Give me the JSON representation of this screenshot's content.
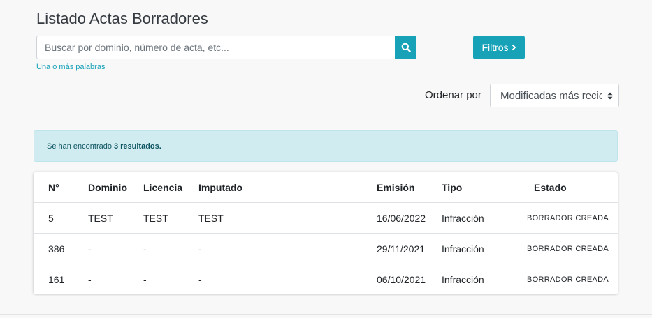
{
  "page": {
    "title": "Listado Actas Borradores"
  },
  "search": {
    "placeholder": "Buscar por dominio, número de acta, etc...",
    "value": "",
    "hint": "Una o más palabras",
    "button_icon": "search-icon"
  },
  "filters": {
    "label": "Filtros",
    "icon": "chevron-right-icon"
  },
  "order": {
    "label": "Ordenar por",
    "selected": "Modificadas más recientes"
  },
  "results": {
    "prefix": "Se han encontrado",
    "count_text": "3 resultados."
  },
  "table": {
    "headers": [
      "N°",
      "Dominio",
      "Licencia",
      "Imputado",
      "Emisión",
      "Tipo",
      "Estado"
    ],
    "rows": [
      {
        "num": "5",
        "dominio": "TEST",
        "licencia": "TEST",
        "imputado": "TEST",
        "emision": "16/06/2022",
        "tipo": "Infracción",
        "estado": "BORRADOR CREADA"
      },
      {
        "num": "386",
        "dominio": "-",
        "licencia": "-",
        "imputado": "-",
        "emision": "29/11/2021",
        "tipo": "Infracción",
        "estado": "BORRADOR CREADA"
      },
      {
        "num": "161",
        "dominio": "-",
        "licencia": "-",
        "imputado": "-",
        "emision": "06/10/2021",
        "tipo": "Infracción",
        "estado": "BORRADOR CREADA"
      }
    ]
  },
  "colors": {
    "accent": "#17a2b8",
    "alert_bg": "#d1ecf1",
    "alert_text": "#0c5460"
  }
}
